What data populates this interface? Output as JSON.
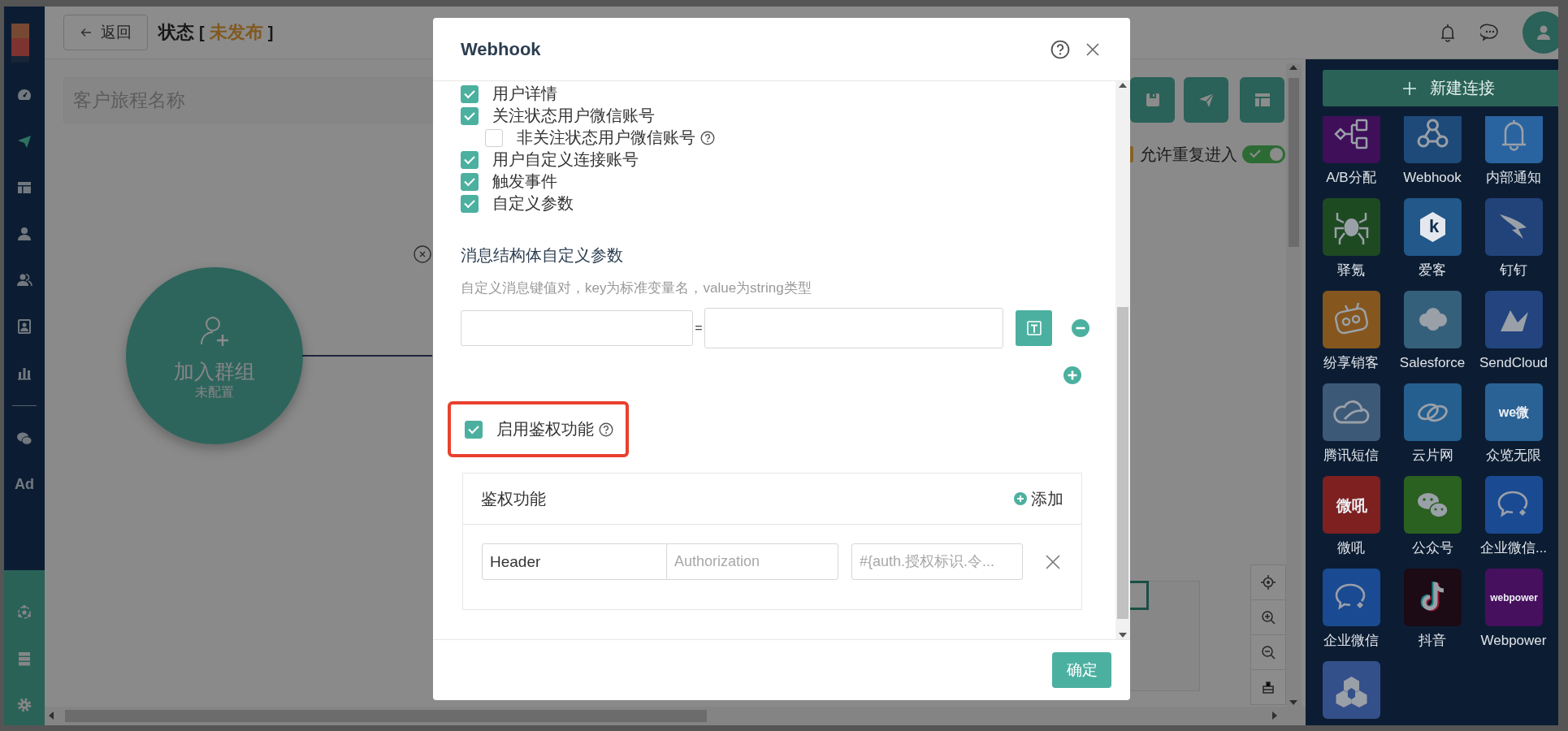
{
  "sidebar": {
    "items": [
      {
        "kind": "icon",
        "selected": false
      },
      {
        "kind": "icon",
        "selected": true
      },
      {
        "kind": "icon",
        "selected": false
      },
      {
        "kind": "icon",
        "selected": false
      },
      {
        "kind": "icon",
        "selected": false
      },
      {
        "kind": "icon",
        "selected": false
      },
      {
        "kind": "icon",
        "selected": false
      },
      {
        "kind": "divider"
      },
      {
        "kind": "icon",
        "selected": false
      },
      {
        "kind": "text",
        "label": "Ad",
        "selected": false
      }
    ]
  },
  "topbar": {
    "back_button": "返回",
    "title": "状态",
    "status_open": "[",
    "status": "未发布",
    "status_close": "]"
  },
  "journey_name": {
    "placeholder": "客户旅程名称"
  },
  "canvas": {
    "nodes": [
      {
        "title": "加入群组",
        "subtitle": "未配置"
      }
    ],
    "reentry": {
      "label": "允许重复进入",
      "on": true
    }
  },
  "connections_panel": {
    "new_button": "新建连接",
    "tiles": [
      {
        "label": "A/B分配",
        "color": "#3f0f5a"
      },
      {
        "label": "Webhook",
        "color": "#1e4a7a"
      },
      {
        "label": "内部通知",
        "color": "#2a64a0"
      },
      {
        "label": "驿氪",
        "color": "#1e4a22"
      },
      {
        "label": "爱客",
        "color": "#22588a",
        "logo_text": "k"
      },
      {
        "label": "钉钉",
        "color": "#22427a"
      },
      {
        "label": "纷享销客",
        "color": "#85561e"
      },
      {
        "label": "Salesforce",
        "color": "#35607b"
      },
      {
        "label": "SendCloud",
        "color": "#23447f"
      },
      {
        "label": "腾讯短信",
        "color": "#3c5a78"
      },
      {
        "label": "云片网",
        "color": "#255f8f"
      },
      {
        "label": "众览无限",
        "color": "#2a6296",
        "logo_text": "we微"
      },
      {
        "label": "微吼",
        "color": "#7e2020",
        "logo_text": "微吼"
      },
      {
        "label": "公众号",
        "color": "#2a6020"
      },
      {
        "label": "企业微信...",
        "color": "#1a4a92"
      },
      {
        "label": "企业微信",
        "color": "#1a4a92"
      },
      {
        "label": "抖音",
        "color": "#1c0a14"
      },
      {
        "label": "Webpower",
        "color": "#46105e",
        "logo_text": "webpower"
      },
      {
        "color": "#33508a"
      }
    ]
  },
  "modal": {
    "title": "Webhook",
    "options": [
      {
        "label": "用户详情",
        "checked": true
      },
      {
        "label": "关注状态用户微信账号",
        "checked": true,
        "children": [
          {
            "label": "非关注状态用户微信账号",
            "checked": false,
            "help": true
          }
        ]
      },
      {
        "label": "用户自定义连接账号",
        "checked": true
      },
      {
        "label": "触发事件",
        "checked": true
      },
      {
        "label": "自定义参数",
        "checked": true
      }
    ],
    "custom_params": {
      "title": "消息结构体自定义参数",
      "hint": "自定义消息键值对，key为标准变量名，value为string类型",
      "rows": [
        {
          "separator": "="
        }
      ]
    },
    "auth": {
      "label": "启用鉴权功能",
      "checked": true,
      "help": true,
      "highlighted": true,
      "panel_title": "鉴权功能",
      "add_button": "添加",
      "rows": [
        {
          "location": "Header",
          "key_placeholder": "Authorization",
          "value_placeholder": "#{auth.授权标识.令..."
        }
      ]
    },
    "confirm_button": "确定"
  }
}
